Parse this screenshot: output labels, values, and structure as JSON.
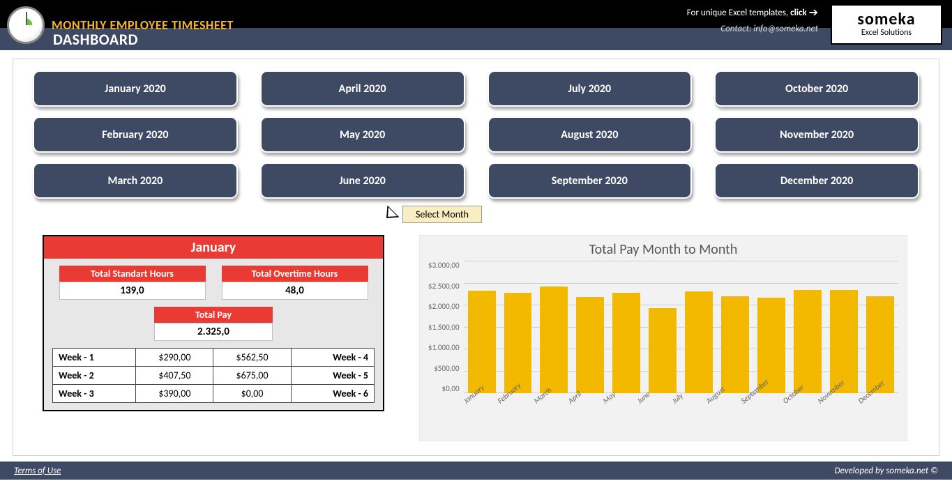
{
  "header": {
    "title": "MONTHLY EMPLOYEE TIMESHEET",
    "subtitle": "DASHBOARD",
    "promo_text": "For unique Excel templates, ",
    "promo_click": "click",
    "contact_label": "Contact: info@someka.net",
    "logo_main": "someka",
    "logo_sub": "Excel Solutions"
  },
  "months": [
    "January 2020",
    "February 2020",
    "March 2020",
    "April 2020",
    "May 2020",
    "June 2020",
    "July 2020",
    "August 2020",
    "September 2020",
    "October 2020",
    "November 2020",
    "December 2020"
  ],
  "pointer_label": "Select Month",
  "summary": {
    "month": "January",
    "std_label": "Total Standart Hours",
    "std_val": "139,0",
    "ot_label": "Total Overtime Hours",
    "ot_val": "48,0",
    "tp_label": "Total Pay",
    "tp_val": "2.325,0",
    "weeks": [
      {
        "left_label": "Week - 1",
        "left_amt": "$290,00",
        "right_amt": "$562,50",
        "right_label": "Week - 4"
      },
      {
        "left_label": "Week - 2",
        "left_amt": "$407,50",
        "right_amt": "$675,00",
        "right_label": "Week - 5"
      },
      {
        "left_label": "Week - 3",
        "left_amt": "$390,00",
        "right_amt": "$0,00",
        "right_label": "Week - 6"
      }
    ]
  },
  "chart_data": {
    "type": "bar",
    "title": "Total Pay Month to Month",
    "ylabel": "",
    "xlabel": "",
    "ylim": [
      0,
      3000
    ],
    "y_ticks": [
      "$3.000,00",
      "$2.500,00",
      "$2.000,00",
      "$1.500,00",
      "$1.000,00",
      "$500,00",
      "$0,00"
    ],
    "categories": [
      "January",
      "February",
      "March",
      "April",
      "May",
      "June",
      "July",
      "August",
      "September",
      "October",
      "November",
      "December"
    ],
    "values": [
      2325,
      2280,
      2420,
      2180,
      2270,
      1920,
      2300,
      2200,
      2170,
      2340,
      2330,
      2200
    ]
  },
  "footer": {
    "terms": "Terms of Use",
    "dev": "Developed by someka.net ©"
  }
}
